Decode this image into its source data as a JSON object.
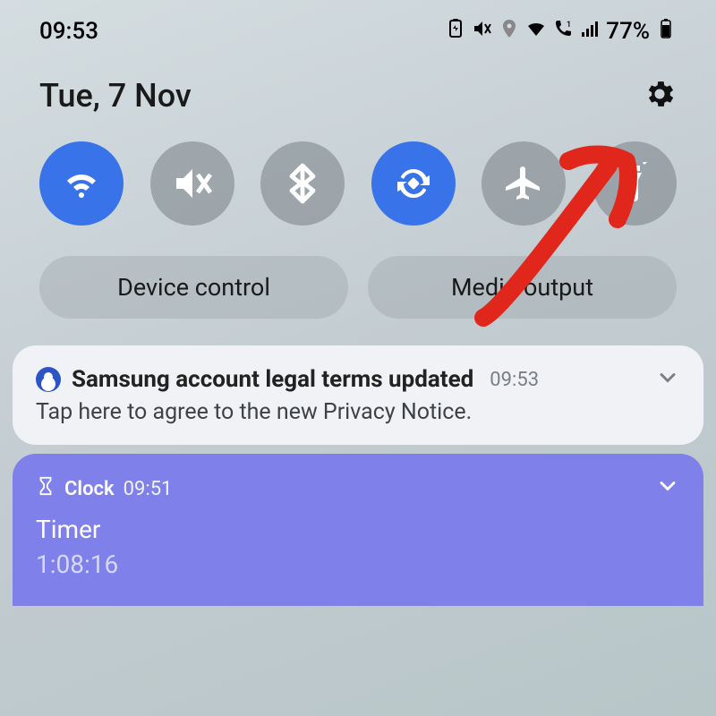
{
  "statusbar": {
    "time": "09:53",
    "battery_percent": "77%"
  },
  "header": {
    "date": "Tue, 7 Nov"
  },
  "pills": {
    "device_control": "Device control",
    "media_output": "Media output"
  },
  "notifications": {
    "samsung": {
      "title": "Samsung account legal terms updated",
      "time": "09:53",
      "body": "Tap here to agree to the new Privacy Notice."
    },
    "clock": {
      "app": "Clock",
      "time": "09:51",
      "title": "Timer",
      "countdown": "1:08:16"
    }
  }
}
